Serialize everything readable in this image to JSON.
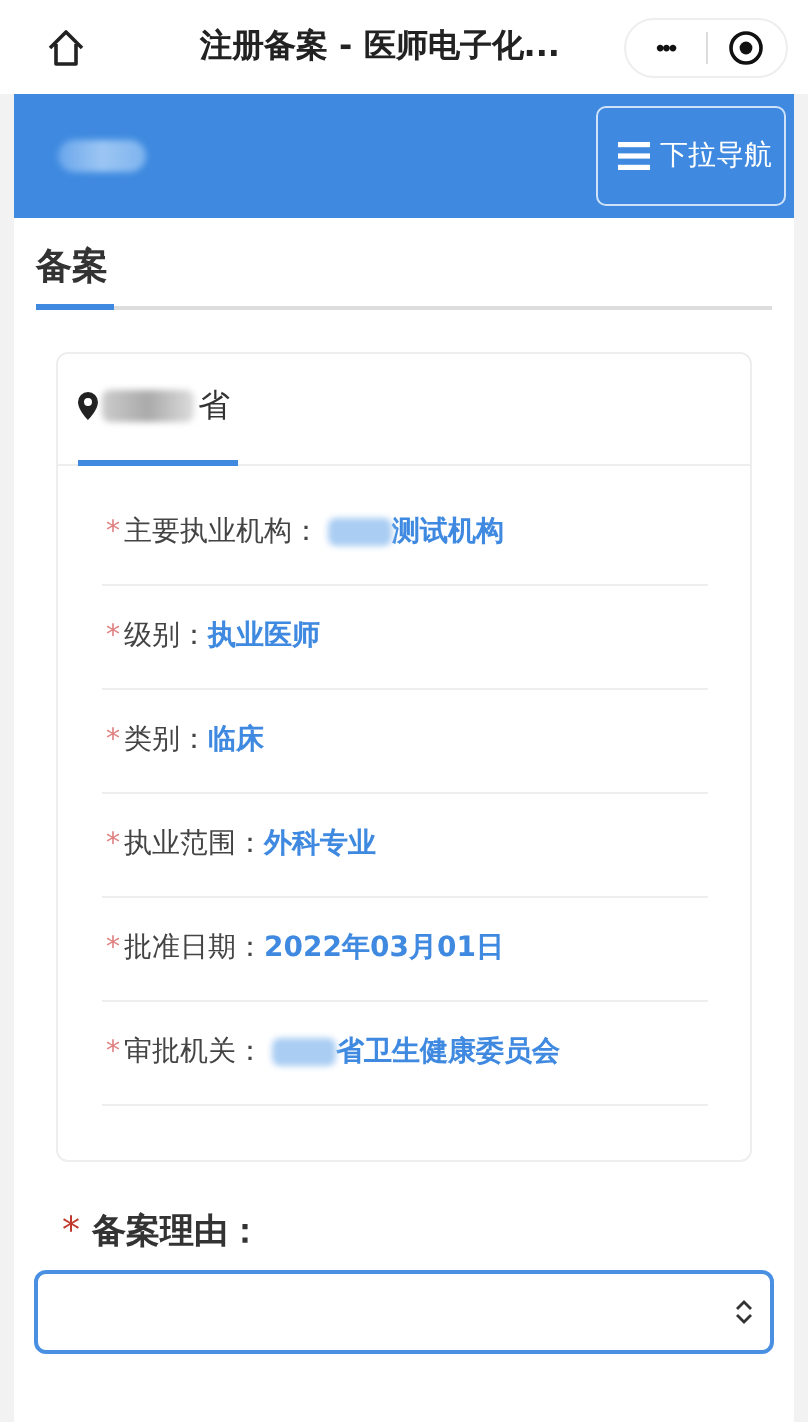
{
  "window": {
    "title": "注册备案 - 医师电子化...",
    "more_button": "•••"
  },
  "header": {
    "nav_button": "下拉导航"
  },
  "section": {
    "title": "备案"
  },
  "card": {
    "tab": {
      "label": "省",
      "selected": true
    },
    "rows": [
      {
        "mark": "*",
        "label": "主要执业机构：",
        "value": "测试机构",
        "redacted_prefix": true
      },
      {
        "mark": "*",
        "label": "级别：",
        "value": "执业医师",
        "redacted_prefix": false
      },
      {
        "mark": "*",
        "label": "类别：",
        "value": "临床",
        "redacted_prefix": false
      },
      {
        "mark": "*",
        "label": "执业范围：",
        "value": "外科专业",
        "redacted_prefix": false
      },
      {
        "mark": "*",
        "label": "批准日期：",
        "value": "2022年03月01日",
        "redacted_prefix": false
      },
      {
        "mark": "*",
        "label": "审批机关：",
        "value": "省卫生健康委员会",
        "redacted_prefix": true
      }
    ]
  },
  "reason": {
    "mark": "*",
    "label": "备案理由："
  }
}
